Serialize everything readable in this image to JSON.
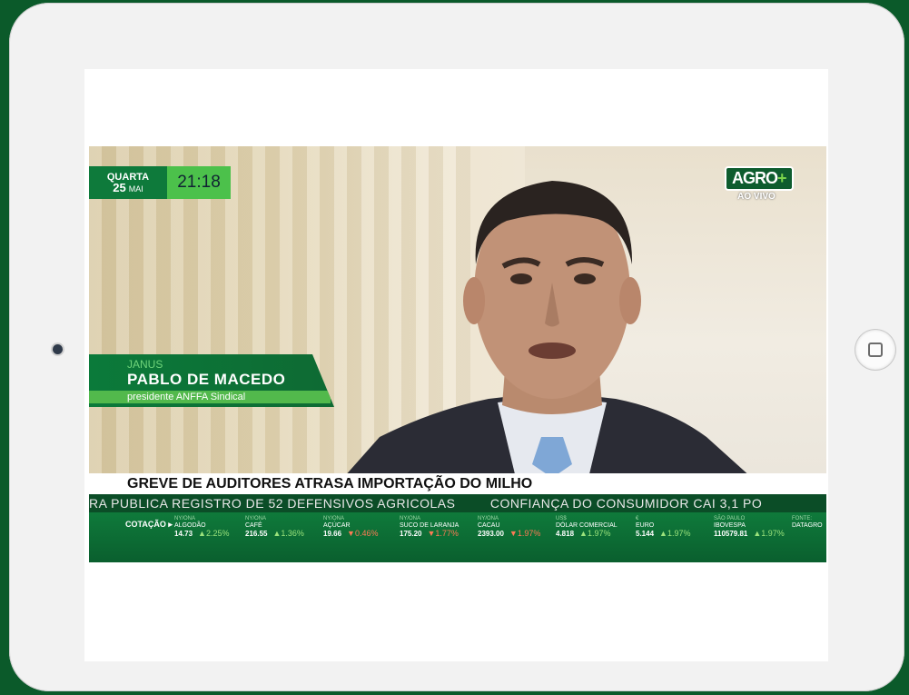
{
  "clock": {
    "weekday": "QUARTA",
    "day": "25",
    "month": "MAI",
    "time": "21:18"
  },
  "logo": {
    "brand": "AGRO",
    "plus": "+",
    "live": "AO VIVO"
  },
  "lower_third": {
    "company": "JANUS",
    "name": "PABLO DE MACEDO",
    "role": "presidente ANFFA Sindical"
  },
  "headline": "GREVE DE AUDITORES ATRASA IMPORTAÇÃO DO MILHO",
  "crawl": [
    "RA PUBLICA REGISTRO DE 52 DEFENSIVOS AGRICOLAS",
    "CONFIANÇA DO CONSUMIDOR CAI 3,1 PO"
  ],
  "quotes": {
    "label": "COTAÇÃO ▸",
    "items": [
      {
        "src": "NY/ONA",
        "name": "ALGODÃO",
        "value": "14.73",
        "change": "▲2.25%",
        "neg": false
      },
      {
        "src": "NY/ONA",
        "name": "CAFÉ",
        "value": "216.55",
        "change": "▲1.36%",
        "neg": false
      },
      {
        "src": "NY/ONA",
        "name": "AÇÚCAR",
        "value": "19.66",
        "change": "▼0.46%",
        "neg": true
      },
      {
        "src": "NY/ONA",
        "name": "SUCO DE LARANJA",
        "value": "175.20",
        "change": "▼1.77%",
        "neg": true
      },
      {
        "src": "NY/ONA",
        "name": "CACAU",
        "value": "2393.00",
        "change": "▼1.97%",
        "neg": true
      },
      {
        "src": "US$",
        "name": "DÓLAR COMERCIAL",
        "value": "4.818",
        "change": "▲1.97%",
        "neg": false
      },
      {
        "src": "€",
        "name": "EURO",
        "value": "5.144",
        "change": "▲1.97%",
        "neg": false
      },
      {
        "src": "SÃO PAULO",
        "name": "IBOVESPA",
        "value": "110579.81",
        "change": "▲1.97%",
        "neg": false
      },
      {
        "src": "FONTE:",
        "name": "DATAGRO",
        "value": "",
        "change": "",
        "neg": false
      }
    ]
  }
}
